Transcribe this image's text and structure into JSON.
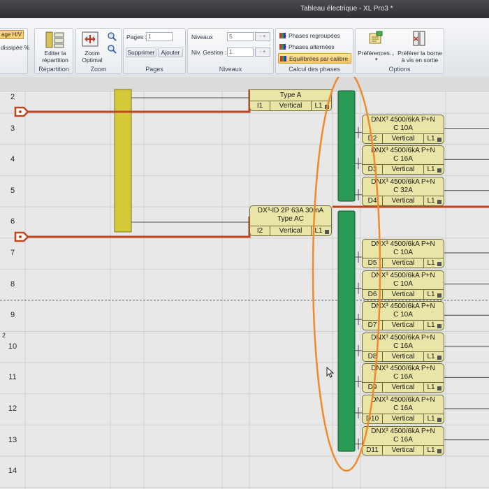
{
  "window": {
    "title": "Tableau électrique - XL Pro3 *"
  },
  "ribbon": {
    "left_partial": {
      "chip_label": "age H/V",
      "text": "dissipée %"
    },
    "repartition": {
      "label": "Répartition",
      "edit_button": "Editer la répartition"
    },
    "zoom": {
      "label": "Zoom",
      "optimal_button": "Zoom Optimal"
    },
    "pages": {
      "label": "Pages",
      "pages_label": "Pages :",
      "pages_value": "1",
      "delete_button": "Supprimer",
      "add_button": "Ajouter"
    },
    "niveaux": {
      "label": "Niveaux",
      "niveaux_label": "Niveaux",
      "niveaux_value": "5",
      "gestion_label": "Niv. Gestion :",
      "gestion_value": "1"
    },
    "phases": {
      "label": "Calcul des phases",
      "grouped": "Phases regroupées",
      "alternated": "Phases alternées",
      "balanced": "Equilibrées par calibre"
    },
    "options": {
      "label": "Options",
      "preferences_button": "Préférences...",
      "prefer_button": "Préférer la borne à vis en sortie"
    }
  },
  "grid": {
    "rows": [
      "2",
      "3",
      "4",
      "5",
      "6",
      "7",
      "8",
      "9",
      "10",
      "11",
      "12",
      "13",
      "14"
    ],
    "page_marker": "2"
  },
  "modules": [
    {
      "line1": "",
      "line2": "Type A",
      "ref": "I1",
      "orientation": "Vertical",
      "phase": "L1"
    },
    {
      "line1": "DX³-ID 2P 63A 30mA",
      "line2": "Type AC",
      "ref": "I2",
      "orientation": "Vertical",
      "phase": "L1"
    },
    {
      "line1": "DNX³ 4500/6kA P+N",
      "line2": "C 10A",
      "ref": "D2",
      "orientation": "Vertical",
      "phase": "L1"
    },
    {
      "line1": "DNX³ 4500/6kA P+N",
      "line2": "C 16A",
      "ref": "D3",
      "orientation": "Vertical",
      "phase": "L1"
    },
    {
      "line1": "DNX³ 4500/6kA P+N",
      "line2": "C 32A",
      "ref": "D4",
      "orientation": "Vertical",
      "phase": "L1"
    },
    {
      "line1": "DNX³ 4500/6kA P+N",
      "line2": "C 10A",
      "ref": "D5",
      "orientation": "Vertical",
      "phase": "L1"
    },
    {
      "line1": "DNX³ 4500/6kA P+N",
      "line2": "C 10A",
      "ref": "D6",
      "orientation": "Vertical",
      "phase": "L1"
    },
    {
      "line1": "DNX³ 4500/6kA P+N",
      "line2": "C 10A",
      "ref": "D7",
      "orientation": "Vertical",
      "phase": "L1"
    },
    {
      "line1": "DNX³ 4500/6kA P+N",
      "line2": "C 16A",
      "ref": "D8",
      "orientation": "Vertical",
      "phase": "L1"
    },
    {
      "line1": "DNX³ 4500/6kA P+N",
      "line2": "C 16A",
      "ref": "D9",
      "orientation": "Vertical",
      "phase": "L1"
    },
    {
      "line1": "DNX³ 4500/6kA P+N",
      "line2": "C 16A",
      "ref": "D10",
      "orientation": "Vertical",
      "phase": "L1"
    },
    {
      "line1": "DNX³ 4500/6kA P+N",
      "line2": "C 16A",
      "ref": "D11",
      "orientation": "Vertical",
      "phase": "L1"
    }
  ],
  "colors": {
    "feeder": "#c0441e",
    "busbar_green": "#2a9a55",
    "busbar_yellow": "#d4c93a",
    "annotation": "#f08a2c",
    "module_fill": "#e9e5a6"
  }
}
